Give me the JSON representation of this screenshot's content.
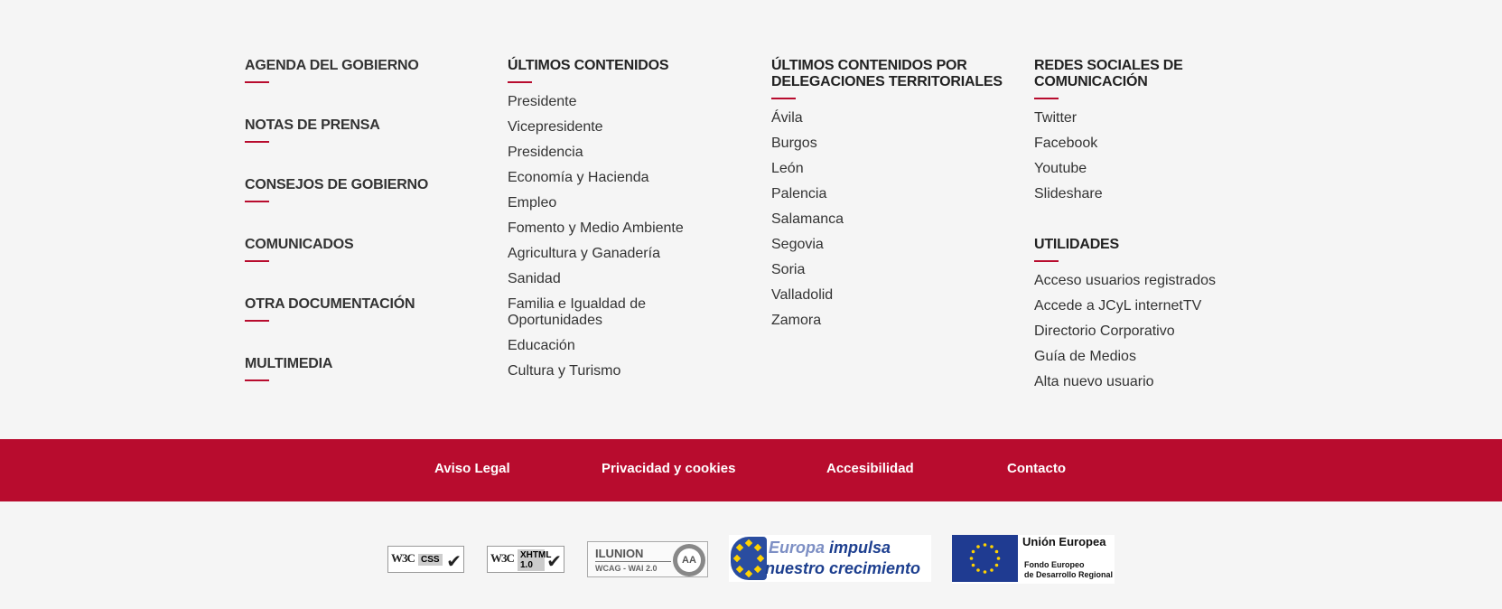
{
  "column1": {
    "headings": [
      "AGENDA DEL GOBIERNO",
      "NOTAS DE PRENSA",
      "CONSEJOS DE GOBIERNO",
      "COMUNICADOS",
      "OTRA DOCUMENTACIÓN",
      "MULTIMEDIA"
    ]
  },
  "column2": {
    "heading": "ÚLTIMOS CONTENIDOS",
    "links": [
      "Presidente",
      "Vicepresidente",
      "Presidencia",
      "Economía y Hacienda",
      "Empleo",
      "Fomento y Medio Ambiente",
      "Agricultura y Ganadería",
      "Sanidad",
      "Familia e Igualdad de Oportunidades",
      "Educación",
      "Cultura y Turismo"
    ]
  },
  "column3": {
    "heading": "ÚLTIMOS CONTENIDOS POR DELEGACIONES TERRITORIALES",
    "links": [
      "Ávila",
      "Burgos",
      "León",
      "Palencia",
      "Salamanca",
      "Segovia",
      "Soria",
      "Valladolid",
      "Zamora"
    ]
  },
  "column4": {
    "heading": "REDES SOCIALES DE COMUNICACIÓN",
    "links": [
      "Twitter",
      "Facebook",
      "Youtube",
      "Slideshare"
    ],
    "utilities_heading": "UTILIDADES",
    "utilities": [
      "Acceso usuarios registrados",
      "Accede a JCyL internetTV",
      "Directorio Corporativo",
      "Guía de Medios",
      "Alta nuevo usuario"
    ]
  },
  "footer_bar": {
    "links": [
      "Aviso Legal",
      "Privacidad y cookies",
      "Accesibilidad",
      "Contacto"
    ],
    "color": "#b80c2e"
  },
  "badges": {
    "w3c_prefix": "W3C",
    "css_tag": "CSS",
    "xhtml_tag": "XHTML 1.0",
    "ilunion_name": "ILUNION",
    "ilunion_sub": "WCAG - WAI  2.0",
    "ilunion_level": "AA",
    "europa_word": "Europa",
    "europa_rest": "impulsa",
    "europa_line2": "nuestro crecimiento",
    "ue_title": "Unión Europea",
    "ue_sub1": "Fondo Europeo",
    "ue_sub2": "de Desarrollo Regional"
  }
}
